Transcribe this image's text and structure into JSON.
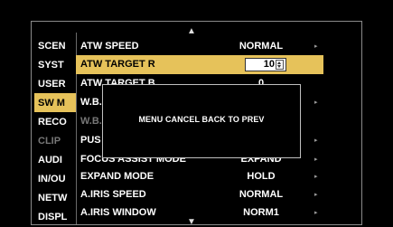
{
  "categories": [
    "SCENE",
    "SYSTEM",
    "USER",
    "SW MODE",
    "RECORDING",
    "CLIP",
    "AUDIO",
    "IN/OUT",
    "NETWORK",
    "DISPLAY"
  ],
  "categories_visible": [
    "SCEN",
    "SYST",
    "USER",
    "SW M",
    "RECO",
    "CLIP",
    "AUDI",
    "IN/OU",
    "NETW",
    "DISPL"
  ],
  "menu": {
    "items": [
      {
        "label": "ATW SPEED",
        "value": "NORMAL"
      },
      {
        "label": "ATW TARGET R",
        "value": "10"
      },
      {
        "label": "ATW TARGET B",
        "value": "0"
      },
      {
        "label": "W.B.",
        "value": ""
      },
      {
        "label": "W.B.",
        "value": ""
      },
      {
        "label": "PUS",
        "value": ""
      },
      {
        "label": "FOCUS ASSIST MODE",
        "value": "EXPAND"
      },
      {
        "label": "EXPAND MODE",
        "value": "HOLD"
      },
      {
        "label": "A.IRIS SPEED",
        "value": "NORMAL"
      },
      {
        "label": "A.IRIS WINDOW",
        "value": "NORM1"
      }
    ]
  },
  "dialog": {
    "message": "MENU CANCEL BACK TO PREV"
  },
  "icons": {
    "scroll_up": "▲",
    "scroll_down": "▼",
    "submenu": "▸"
  },
  "colors": {
    "highlight": "#e6c25a",
    "background": "#000000"
  }
}
